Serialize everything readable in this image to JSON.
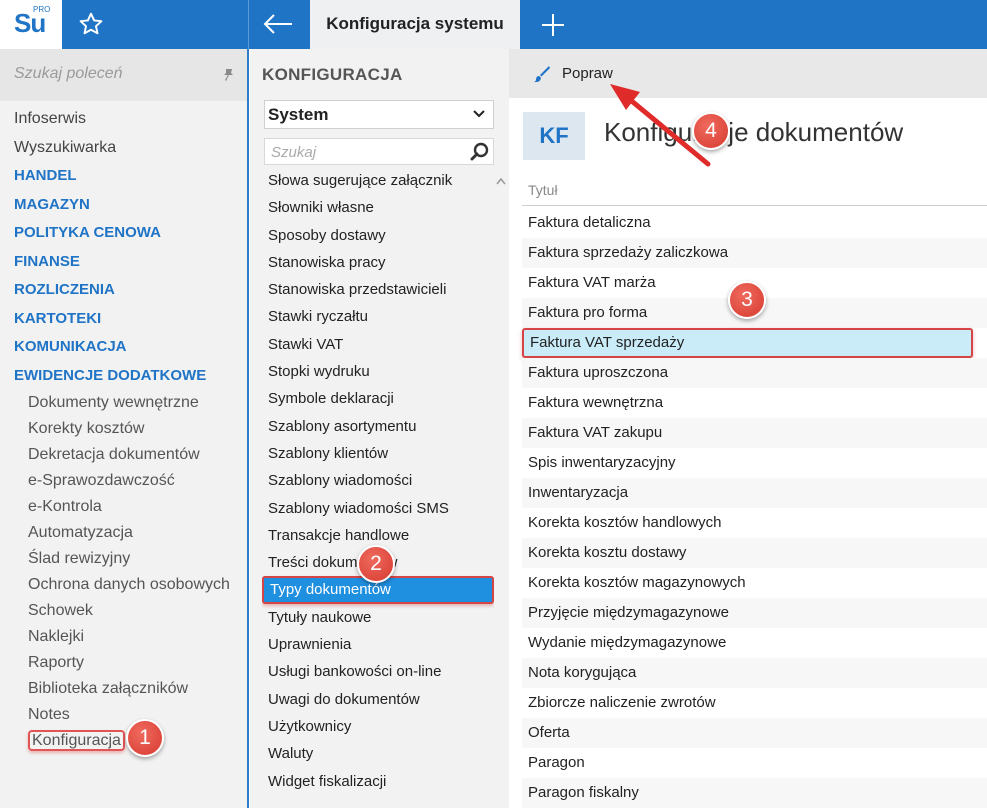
{
  "topbar": {
    "logo_text": "Su",
    "logo_sup": "PRO",
    "active_tab": "Konfiguracja systemu",
    "accent": "#1f74c6"
  },
  "sidebar": {
    "search_placeholder": "Szukaj poleceń",
    "items": [
      {
        "label": "Infoserwis",
        "kind": "plain"
      },
      {
        "label": "Wyszukiwarka",
        "kind": "plain"
      },
      {
        "label": "HANDEL",
        "kind": "module"
      },
      {
        "label": "MAGAZYN",
        "kind": "module"
      },
      {
        "label": "POLITYKA CENOWA",
        "kind": "module"
      },
      {
        "label": "FINANSE",
        "kind": "module"
      },
      {
        "label": "ROZLICZENIA",
        "kind": "module"
      },
      {
        "label": "KARTOTEKI",
        "kind": "module"
      },
      {
        "label": "KOMUNIKACJA",
        "kind": "module"
      },
      {
        "label": "EWIDENCJE DODATKOWE",
        "kind": "module"
      },
      {
        "label": "Dokumenty wewnętrzne",
        "kind": "sub"
      },
      {
        "label": "Korekty kosztów",
        "kind": "sub"
      },
      {
        "label": "Dekretacja dokumentów",
        "kind": "sub"
      },
      {
        "label": "e-Sprawozdawczość",
        "kind": "sub"
      },
      {
        "label": "e-Kontrola",
        "kind": "sub"
      },
      {
        "label": "Automatyzacja",
        "kind": "sub"
      },
      {
        "label": "Ślad rewizyjny",
        "kind": "sub"
      },
      {
        "label": "Ochrona danych osobowych",
        "kind": "sub"
      },
      {
        "label": "Schowek",
        "kind": "sub"
      },
      {
        "label": "Naklejki",
        "kind": "sub"
      },
      {
        "label": "Raporty",
        "kind": "sub"
      },
      {
        "label": "Biblioteka załączników",
        "kind": "sub"
      },
      {
        "label": "Notes",
        "kind": "sub"
      },
      {
        "label": "Konfiguracja",
        "kind": "sub",
        "highlighted": true
      }
    ]
  },
  "middle": {
    "title": "KONFIGURACJA",
    "select_value": "System",
    "search_placeholder": "Szukaj",
    "items": [
      "Słowa sugerujące załącznik",
      "Słowniki własne",
      "Sposoby dostawy",
      "Stanowiska pracy",
      "Stanowiska przedstawicieli",
      "Stawki ryczałtu",
      "Stawki VAT",
      "Stopki wydruku",
      "Symbole deklaracji",
      "Szablony asortymentu",
      "Szablony klientów",
      "Szablony wiadomości",
      "Szablony wiadomości SMS",
      "Transakcje handlowe",
      "Treści dokumentów",
      "Typy dokumentów",
      "Tytuły naukowe",
      "Uprawnienia",
      "Usługi bankowości on-line",
      "Uwagi do dokumentów",
      "Użytkownicy",
      "Waluty",
      "Widget fiskalizacji"
    ],
    "selected_index": 15
  },
  "content": {
    "toolbar_button": "Popraw",
    "icon_badge": "KF",
    "page_title": "Konfiguracje dokumentów",
    "column_header": "Tytuł",
    "rows": [
      "Faktura detaliczna",
      "Faktura sprzedaży zaliczkowa",
      "Faktura VAT marża",
      "Faktura pro forma",
      "Faktura VAT sprzedaży",
      "Faktura uproszczona",
      "Faktura wewnętrzna",
      "Faktura VAT zakupu",
      "Spis inwentaryzacyjny",
      "Inwentaryzacja",
      "Korekta kosztów handlowych",
      "Korekta kosztu dostawy",
      "Korekta kosztów magazynowych",
      "Przyjęcie międzymagazynowe",
      "Wydanie międzymagazynowe",
      "Nota korygująca",
      "Zbiorcze naliczenie zwrotów",
      "Oferta",
      "Paragon",
      "Paragon fiskalny"
    ],
    "selected_index": 4
  },
  "annotations": {
    "step1": "1",
    "step2": "2",
    "step3": "3",
    "step4": "4",
    "color": "#d63a2f"
  }
}
